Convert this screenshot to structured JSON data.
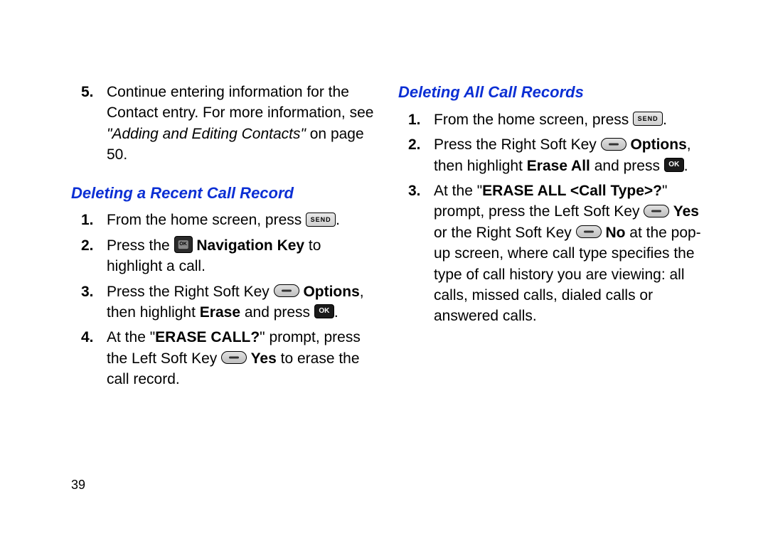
{
  "pageNumber": "39",
  "left": {
    "step5": {
      "num": "5.",
      "a": "Continue entering information for the Contact entry. For more information, see ",
      "b": "\"Adding and Editing Contacts\"",
      "c": " on page 50."
    },
    "heading": "Deleting a Recent Call Record",
    "s1": {
      "num": "1.",
      "a": "From the home screen, press ",
      "z": "."
    },
    "s2": {
      "num": "2.",
      "a": "Press the ",
      "b": " Navigation Key",
      "c": " to highlight a call."
    },
    "s3": {
      "num": "3.",
      "a": "Press the Right Soft Key ",
      "b": " Options",
      "c": ", then highlight ",
      "d": "Erase",
      "e": " and press ",
      "z": "."
    },
    "s4": {
      "num": "4.",
      "a": "At the \"",
      "b": "ERASE CALL?",
      "c": "\" prompt, press the Left Soft Key ",
      "d": " Yes",
      "e": " to erase the call record."
    }
  },
  "right": {
    "heading": "Deleting All Call Records",
    "s1": {
      "num": "1.",
      "a": "From the home screen, press ",
      "z": "."
    },
    "s2": {
      "num": "2.",
      "a": "Press the Right Soft Key ",
      "b": " Options",
      "c": ", then highlight ",
      "d": "Erase All",
      "e": " and press ",
      "z": "."
    },
    "s3": {
      "num": "3.",
      "a": "At the \"",
      "b": "ERASE ALL <Call Type>?",
      "c": "\" prompt, press the Left Soft Key ",
      "d": " Yes",
      "e": " or the Right Soft Key ",
      "f": " No",
      "g": " at the  pop-up screen, where call type specifies the type of call history you are viewing: all calls, missed calls, dialed calls or answered calls."
    }
  },
  "icons": {
    "send": "SEND",
    "ok": "OK"
  }
}
